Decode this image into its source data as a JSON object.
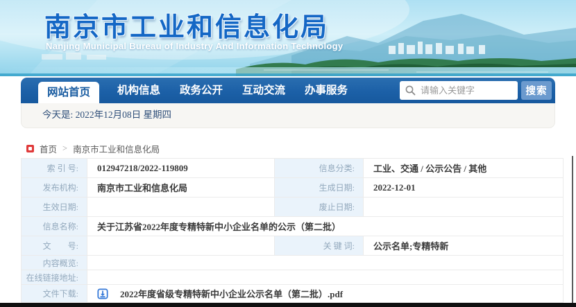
{
  "header": {
    "title": "南京市工业和信息化局",
    "subtitle": "Nanjing Municipal Bureau of Industry And Information Technology"
  },
  "nav": {
    "tabs": [
      {
        "label": "网站首页",
        "active": true
      },
      {
        "label": "机构信息",
        "active": false
      },
      {
        "label": "政务公开",
        "active": false
      },
      {
        "label": "互动交流",
        "active": false
      },
      {
        "label": "办事服务",
        "active": false
      }
    ],
    "search": {
      "placeholder": "请输入关键字",
      "button_label": "搜索",
      "icon": "search-icon"
    }
  },
  "date_bar": {
    "text": "今天是: 2022年12月08日  星期四"
  },
  "breadcrumb": {
    "home_icon": "red-home-marker-icon",
    "home": "首页",
    "separator": ">",
    "current": "南京市工业和信息化局"
  },
  "info_table": {
    "r1": {
      "l1": "索 引 号:",
      "v1": "012947218/2022-119809",
      "l2": "信息分类:",
      "v2": "工业、交通 / 公示公告 / 其他"
    },
    "r2": {
      "l1": "发布机构:",
      "v1": "南京市工业和信息化局",
      "l2": "生成日期:",
      "v2": "2022-12-01"
    },
    "r3": {
      "l1": "生效日期:",
      "v1": "",
      "l2": "废止日期:",
      "v2": ""
    },
    "r4": {
      "l1": "信息名称:",
      "v1": "关于江苏省2022年度专精特新中小企业名单的公示（第二批）"
    },
    "r5": {
      "l1": "文　　号:",
      "v1": "",
      "l2": "关 键 词:",
      "v2": "公示名单;专精特新"
    },
    "r6": {
      "l1": "内容概览:",
      "v1": ""
    },
    "r7": {
      "l1": "在线链接地址:",
      "v1": ""
    },
    "r8": {
      "l1": "文件下载:",
      "download_icon": "download-icon",
      "file_name": "2022年度省级专精特新中小企业公示名单（第二批）.pdf"
    }
  },
  "colors": {
    "nav_blue": "#1b5fa6",
    "active_tab_text": "#15599f",
    "search_button_blue": "#6b9ace",
    "title_blue": "#1467c5",
    "label_cell_bg": "#eaf3fb",
    "label_text": "#93a9bd",
    "value_text": "#3a3a3a",
    "date_text_navy": "#2e4e79",
    "breadcrumb_icon_red": "#e03a3a",
    "download_icon_blue": "#3579d8"
  }
}
